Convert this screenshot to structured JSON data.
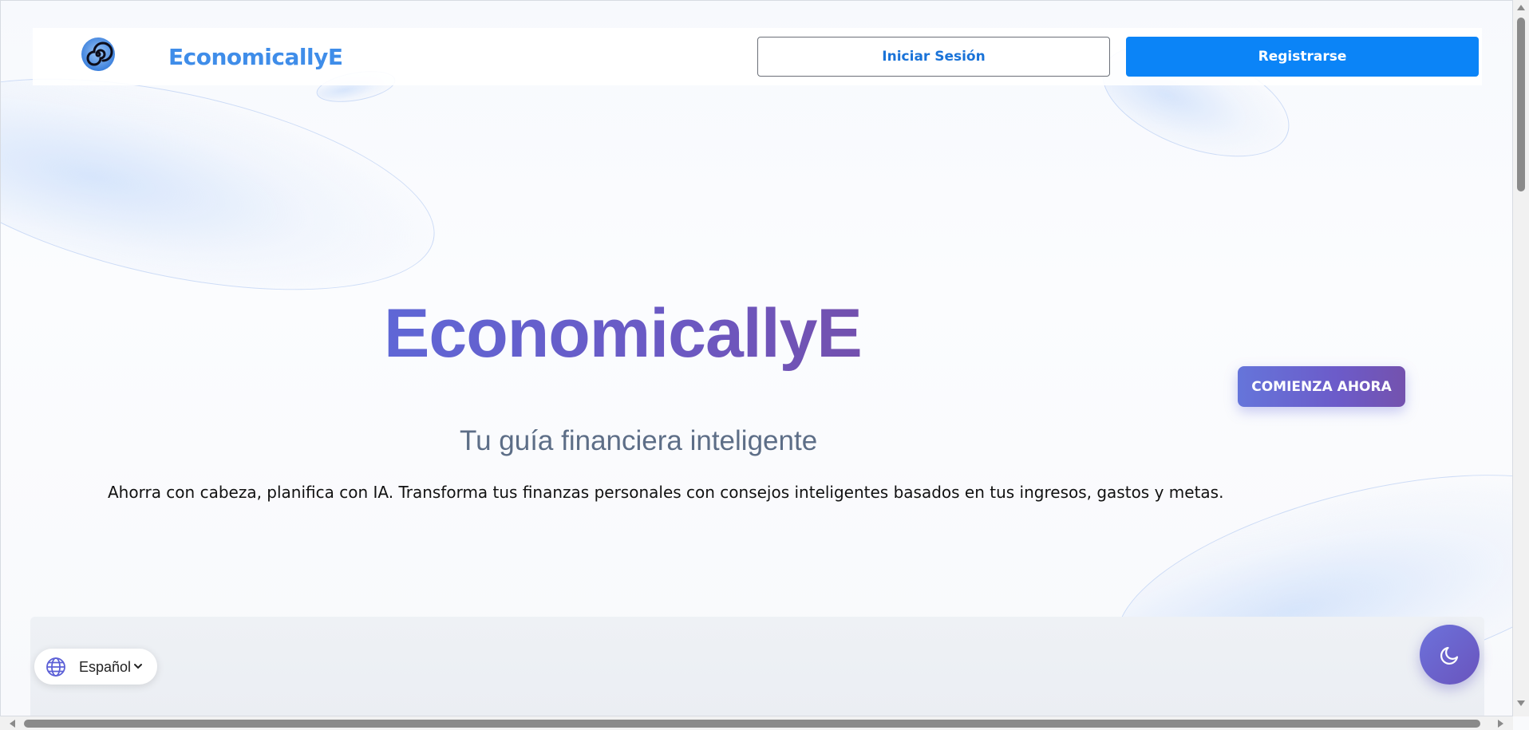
{
  "header": {
    "brand": "EconomicallyE",
    "login_label": "Iniciar Sesión",
    "register_label": "Registrarse"
  },
  "hero": {
    "title": "EconomicallyE",
    "subtitle": "Tu guía financiera inteligente",
    "description": "Ahorra con cabeza, planifica con IA. Transforma tus finanzas personales con consejos inteligentes basados en tus ingresos, gastos y metas.",
    "cta_label": "COMIENZA AHORA"
  },
  "language": {
    "selected": "Español",
    "icon": "globe-icon"
  },
  "theme_toggle": {
    "icon": "moon-icon"
  },
  "colors": {
    "brand": "#3f8de9",
    "primary_button": "#0b84f7",
    "title_gradient_start": "#5f67d6",
    "title_gradient_end": "#7350ae",
    "subtitle": "#5d6e87"
  }
}
